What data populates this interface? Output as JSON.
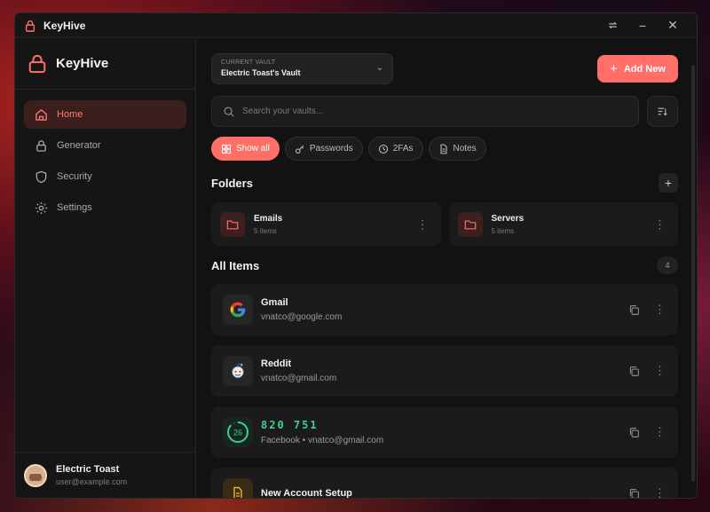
{
  "window": {
    "title": "KeyHive"
  },
  "sidebar": {
    "brand": "KeyHive",
    "items": [
      {
        "label": "Home",
        "icon": "home-icon",
        "active": true
      },
      {
        "label": "Generator",
        "icon": "lock-icon",
        "active": false
      },
      {
        "label": "Security",
        "icon": "shield-icon",
        "active": false
      },
      {
        "label": "Settings",
        "icon": "gear-icon",
        "active": false
      }
    ],
    "user": {
      "name": "Electric Toast",
      "email": "user@example.com"
    }
  },
  "vault": {
    "label": "CURRENT VAULT",
    "name": "Electric Toast's Vault"
  },
  "add_button": "Add New",
  "search": {
    "placeholder": "Search your vaults..."
  },
  "filters": [
    {
      "label": "Show all",
      "icon": "grid-icon",
      "active": true
    },
    {
      "label": "Passwords",
      "icon": "key-icon",
      "active": false
    },
    {
      "label": "2FAs",
      "icon": "clock-icon",
      "active": false
    },
    {
      "label": "Notes",
      "icon": "document-icon",
      "active": false
    }
  ],
  "folders_section": {
    "title": "Folders"
  },
  "folders": [
    {
      "name": "Emails",
      "count": "5 items"
    },
    {
      "name": "Servers",
      "count": "5 items"
    }
  ],
  "items_section": {
    "title": "All Items",
    "count": "4"
  },
  "items": [
    {
      "title": "Gmail",
      "subtitle": "vnatco@google.com",
      "icon": "google-icon"
    },
    {
      "title": "Reddit",
      "subtitle": "vnatco@gmail.com",
      "icon": "reddit-icon"
    },
    {
      "code": "820 751",
      "subtitle": "Facebook • vnatco@gmail.com",
      "timer": "26",
      "icon": "totp-timer-icon"
    },
    {
      "title": "New Account Setup",
      "icon": "note-icon"
    }
  ],
  "colors": {
    "accent": "#ff6f67",
    "totp": "#3fcf8e",
    "background": "#121212"
  }
}
